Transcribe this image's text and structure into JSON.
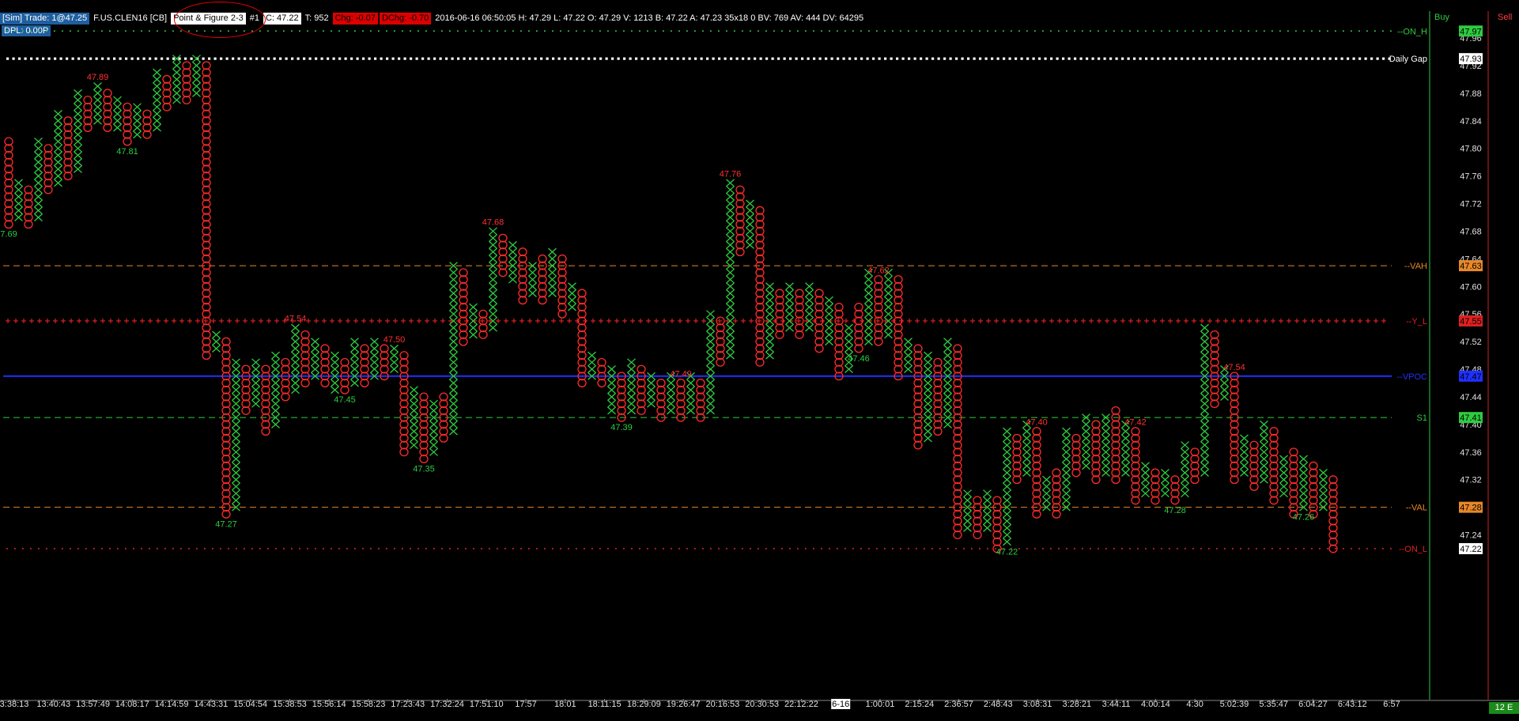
{
  "header": {
    "account": "[Sim]  Trade: 1@47.25",
    "instrument": "F.US.CLEN16 [CB]",
    "chart_type": "Point & Figure 2-3",
    "chart_no": "#1",
    "close": "C: 47.22",
    "ticks": "T: 952",
    "chg": "Chg: -0.07",
    "dchg": "DChg: -0.70",
    "stats": "2016-06-16 06:50:05  H: 47.29  L: 47.22  O: 47.29  V: 1213  B: 47.22  A: 47.23  35x18 0  BV: 769  AV: 444  DV: 64295",
    "dpl": "DPL: 0.00P",
    "buy": "Buy",
    "sell": "Sell",
    "corner": "12 E"
  },
  "chart_data": {
    "type": "point-and-figure",
    "ylim": [
      47.22,
      47.97
    ],
    "box_size": 0.01,
    "y_ticks": [
      47.96,
      47.92,
      47.88,
      47.84,
      47.8,
      47.76,
      47.72,
      47.68,
      47.64,
      47.6,
      47.56,
      47.52,
      47.48,
      47.44,
      47.4,
      47.36,
      47.32,
      47.28,
      47.24
    ],
    "x_ticks": [
      "3:38:13",
      "13:40:43",
      "13:57:49",
      "14:08:17",
      "14:14:59",
      "14:43:31",
      "15:04:54",
      "15:38:53",
      "15:56:14",
      "15:58:23",
      "17:23:43",
      "17:32:24",
      "17:51:10",
      "17:57",
      "18:01",
      "18:11:15",
      "18:29:09",
      "19:26:47",
      "20:16:53",
      "20:30:53",
      "22:12:22",
      "6-16",
      "1:00:01",
      "2:15:24",
      "2:36:57",
      "2:48:43",
      "3:08:31",
      "3:28:21",
      "3:44:11",
      "4:00:14",
      "4:30",
      "5:02:39",
      "5:35:47",
      "6:04:27",
      "6:43:12",
      "6:57"
    ],
    "levels": [
      {
        "name": "ON_H",
        "label": "--ON_H",
        "value": 47.97,
        "style": "dots",
        "color": "#2ecc40",
        "badge_color": "#2ecc40"
      },
      {
        "name": "Daily Gap",
        "label": "Daily Gap",
        "value": 47.93,
        "style": "bigdots",
        "color": "#ffffff",
        "badge_color": "#ffffff"
      },
      {
        "name": "VAH",
        "label": "--VAH",
        "value": 47.63,
        "style": "dash",
        "color": "#e8872a",
        "badge_color": "#e8872a"
      },
      {
        "name": "Y_L",
        "label": "--Y_L",
        "value": 47.55,
        "style": "plus",
        "color": "#e02020",
        "badge_color": "#e02020"
      },
      {
        "name": "VPOC",
        "label": "--VPOC",
        "value": 47.47,
        "style": "solid",
        "color": "#2030ff",
        "badge_color": "#2030ff"
      },
      {
        "name": "S1",
        "label": "S1",
        "value": 47.41,
        "style": "dash",
        "color": "#2ecc40",
        "badge_color": "#2ecc40"
      },
      {
        "name": "VAL",
        "label": "--VAL",
        "value": 47.28,
        "style": "dash",
        "color": "#e8872a",
        "badge_color": "#e8872a"
      },
      {
        "name": "ON_L",
        "label": "--ON_L",
        "value": 47.22,
        "style": "dots",
        "color": "#e02020",
        "badge_color": "#ffffff"
      }
    ],
    "columns": [
      {
        "t": "O",
        "h": 47.81,
        "l": 47.69
      },
      {
        "t": "X",
        "h": 47.75,
        "l": 47.7
      },
      {
        "t": "O",
        "h": 47.74,
        "l": 47.69
      },
      {
        "t": "X",
        "h": 47.81,
        "l": 47.7
      },
      {
        "t": "O",
        "h": 47.8,
        "l": 47.74
      },
      {
        "t": "X",
        "h": 47.85,
        "l": 47.75
      },
      {
        "t": "O",
        "h": 47.84,
        "l": 47.76
      },
      {
        "t": "X",
        "h": 47.88,
        "l": 47.77
      },
      {
        "t": "O",
        "h": 47.87,
        "l": 47.83
      },
      {
        "t": "X",
        "h": 47.89,
        "l": 47.84
      },
      {
        "t": "O",
        "h": 47.88,
        "l": 47.83
      },
      {
        "t": "X",
        "h": 47.87,
        "l": 47.83
      },
      {
        "t": "O",
        "h": 47.86,
        "l": 47.81
      },
      {
        "t": "X",
        "h": 47.86,
        "l": 47.82
      },
      {
        "t": "O",
        "h": 47.85,
        "l": 47.82
      },
      {
        "t": "X",
        "h": 47.91,
        "l": 47.83
      },
      {
        "t": "O",
        "h": 47.9,
        "l": 47.86
      },
      {
        "t": "X",
        "h": 47.93,
        "l": 47.87
      },
      {
        "t": "O",
        "h": 47.92,
        "l": 47.87
      },
      {
        "t": "X",
        "h": 47.93,
        "l": 47.88
      },
      {
        "t": "O",
        "h": 47.92,
        "l": 47.5
      },
      {
        "t": "X",
        "h": 47.53,
        "l": 47.51
      },
      {
        "t": "O",
        "h": 47.52,
        "l": 47.27
      },
      {
        "t": "X",
        "h": 47.49,
        "l": 47.28
      },
      {
        "t": "O",
        "h": 47.48,
        "l": 47.42
      },
      {
        "t": "X",
        "h": 47.49,
        "l": 47.43
      },
      {
        "t": "O",
        "h": 47.48,
        "l": 47.39
      },
      {
        "t": "X",
        "h": 47.5,
        "l": 47.4
      },
      {
        "t": "O",
        "h": 47.49,
        "l": 47.44
      },
      {
        "t": "X",
        "h": 47.54,
        "l": 47.45
      },
      {
        "t": "O",
        "h": 47.53,
        "l": 47.46
      },
      {
        "t": "X",
        "h": 47.52,
        "l": 47.47
      },
      {
        "t": "O",
        "h": 47.51,
        "l": 47.46
      },
      {
        "t": "X",
        "h": 47.5,
        "l": 47.45
      },
      {
        "t": "O",
        "h": 47.49,
        "l": 47.45
      },
      {
        "t": "X",
        "h": 47.52,
        "l": 47.46
      },
      {
        "t": "O",
        "h": 47.51,
        "l": 47.46
      },
      {
        "t": "X",
        "h": 47.52,
        "l": 47.47
      },
      {
        "t": "O",
        "h": 47.51,
        "l": 47.47
      },
      {
        "t": "X",
        "h": 47.51,
        "l": 47.48
      },
      {
        "t": "O",
        "h": 47.5,
        "l": 47.36
      },
      {
        "t": "X",
        "h": 47.45,
        "l": 47.37
      },
      {
        "t": "O",
        "h": 47.44,
        "l": 47.35
      },
      {
        "t": "X",
        "h": 47.43,
        "l": 47.36
      },
      {
        "t": "O",
        "h": 47.44,
        "l": 47.38
      },
      {
        "t": "X",
        "h": 47.63,
        "l": 47.39
      },
      {
        "t": "O",
        "h": 47.62,
        "l": 47.52
      },
      {
        "t": "X",
        "h": 47.57,
        "l": 47.53
      },
      {
        "t": "O",
        "h": 47.56,
        "l": 47.53
      },
      {
        "t": "X",
        "h": 47.68,
        "l": 47.54
      },
      {
        "t": "O",
        "h": 47.67,
        "l": 47.62
      },
      {
        "t": "X",
        "h": 47.66,
        "l": 47.61
      },
      {
        "t": "O",
        "h": 47.65,
        "l": 47.58
      },
      {
        "t": "X",
        "h": 47.63,
        "l": 47.59
      },
      {
        "t": "O",
        "h": 47.64,
        "l": 47.58
      },
      {
        "t": "X",
        "h": 47.65,
        "l": 47.59
      },
      {
        "t": "O",
        "h": 47.64,
        "l": 47.56
      },
      {
        "t": "X",
        "h": 47.6,
        "l": 47.57
      },
      {
        "t": "O",
        "h": 47.59,
        "l": 47.46
      },
      {
        "t": "X",
        "h": 47.5,
        "l": 47.47
      },
      {
        "t": "O",
        "h": 47.49,
        "l": 47.46
      },
      {
        "t": "X",
        "h": 47.48,
        "l": 47.42
      },
      {
        "t": "O",
        "h": 47.47,
        "l": 47.41
      },
      {
        "t": "X",
        "h": 47.49,
        "l": 47.42
      },
      {
        "t": "O",
        "h": 47.48,
        "l": 47.42
      },
      {
        "t": "X",
        "h": 47.47,
        "l": 47.43
      },
      {
        "t": "O",
        "h": 47.46,
        "l": 47.41
      },
      {
        "t": "X",
        "h": 47.47,
        "l": 47.42
      },
      {
        "t": "O",
        "h": 47.46,
        "l": 47.41
      },
      {
        "t": "X",
        "h": 47.47,
        "l": 47.42
      },
      {
        "t": "O",
        "h": 47.46,
        "l": 47.41
      },
      {
        "t": "X",
        "h": 47.56,
        "l": 47.42
      },
      {
        "t": "O",
        "h": 47.55,
        "l": 47.49
      },
      {
        "t": "X",
        "h": 47.75,
        "l": 47.5
      },
      {
        "t": "O",
        "h": 47.74,
        "l": 47.65
      },
      {
        "t": "X",
        "h": 47.72,
        "l": 47.66
      },
      {
        "t": "O",
        "h": 47.71,
        "l": 47.49
      },
      {
        "t": "X",
        "h": 47.6,
        "l": 47.5
      },
      {
        "t": "O",
        "h": 47.59,
        "l": 47.53
      },
      {
        "t": "X",
        "h": 47.6,
        "l": 47.54
      },
      {
        "t": "O",
        "h": 47.59,
        "l": 47.53
      },
      {
        "t": "X",
        "h": 47.6,
        "l": 47.54
      },
      {
        "t": "O",
        "h": 47.59,
        "l": 47.51
      },
      {
        "t": "X",
        "h": 47.58,
        "l": 47.52
      },
      {
        "t": "O",
        "h": 47.57,
        "l": 47.47
      },
      {
        "t": "X",
        "h": 47.54,
        "l": 47.48
      },
      {
        "t": "O",
        "h": 47.57,
        "l": 47.51
      },
      {
        "t": "X",
        "h": 47.62,
        "l": 47.52
      },
      {
        "t": "O",
        "h": 47.61,
        "l": 47.52
      },
      {
        "t": "X",
        "h": 47.62,
        "l": 47.53
      },
      {
        "t": "O",
        "h": 47.61,
        "l": 47.47
      },
      {
        "t": "X",
        "h": 47.52,
        "l": 47.48
      },
      {
        "t": "O",
        "h": 47.51,
        "l": 47.37
      },
      {
        "t": "X",
        "h": 47.5,
        "l": 47.38
      },
      {
        "t": "O",
        "h": 47.49,
        "l": 47.39
      },
      {
        "t": "X",
        "h": 47.52,
        "l": 47.4
      },
      {
        "t": "O",
        "h": 47.51,
        "l": 47.24
      },
      {
        "t": "X",
        "h": 47.3,
        "l": 47.25
      },
      {
        "t": "O",
        "h": 47.29,
        "l": 47.24
      },
      {
        "t": "X",
        "h": 47.3,
        "l": 47.25
      },
      {
        "t": "O",
        "h": 47.29,
        "l": 47.22
      },
      {
        "t": "X",
        "h": 47.39,
        "l": 47.23
      },
      {
        "t": "O",
        "h": 47.38,
        "l": 47.32
      },
      {
        "t": "X",
        "h": 47.4,
        "l": 47.33
      },
      {
        "t": "O",
        "h": 47.39,
        "l": 47.27
      },
      {
        "t": "X",
        "h": 47.32,
        "l": 47.28
      },
      {
        "t": "O",
        "h": 47.33,
        "l": 47.27
      },
      {
        "t": "X",
        "h": 47.39,
        "l": 47.28
      },
      {
        "t": "O",
        "h": 47.38,
        "l": 47.33
      },
      {
        "t": "X",
        "h": 47.41,
        "l": 47.34
      },
      {
        "t": "O",
        "h": 47.4,
        "l": 47.32
      },
      {
        "t": "X",
        "h": 47.41,
        "l": 47.33
      },
      {
        "t": "O",
        "h": 47.42,
        "l": 47.32
      },
      {
        "t": "X",
        "h": 47.4,
        "l": 47.33
      },
      {
        "t": "O",
        "h": 47.39,
        "l": 47.29
      },
      {
        "t": "X",
        "h": 47.34,
        "l": 47.3
      },
      {
        "t": "O",
        "h": 47.33,
        "l": 47.29
      },
      {
        "t": "X",
        "h": 47.33,
        "l": 47.3
      },
      {
        "t": "O",
        "h": 47.32,
        "l": 47.29
      },
      {
        "t": "X",
        "h": 47.37,
        "l": 47.3
      },
      {
        "t": "O",
        "h": 47.36,
        "l": 47.32
      },
      {
        "t": "X",
        "h": 47.54,
        "l": 47.33
      },
      {
        "t": "O",
        "h": 47.53,
        "l": 47.43
      },
      {
        "t": "X",
        "h": 47.48,
        "l": 47.44
      },
      {
        "t": "O",
        "h": 47.47,
        "l": 47.32
      },
      {
        "t": "X",
        "h": 47.38,
        "l": 47.33
      },
      {
        "t": "O",
        "h": 47.37,
        "l": 47.31
      },
      {
        "t": "X",
        "h": 47.4,
        "l": 47.32
      },
      {
        "t": "O",
        "h": 47.39,
        "l": 47.29
      },
      {
        "t": "X",
        "h": 47.35,
        "l": 47.3
      },
      {
        "t": "O",
        "h": 47.36,
        "l": 47.27
      },
      {
        "t": "X",
        "h": 47.35,
        "l": 47.28
      },
      {
        "t": "O",
        "h": 47.34,
        "l": 47.27
      },
      {
        "t": "X",
        "h": 47.33,
        "l": 47.28
      },
      {
        "t": "O",
        "h": 47.32,
        "l": 47.22
      }
    ],
    "price_labels": [
      {
        "col": 0,
        "text": "7.69",
        "color": "#2ecc40",
        "pos": "below"
      },
      {
        "col": 9,
        "text": "47.89",
        "color": "#ff3030",
        "pos": "above"
      },
      {
        "col": 12,
        "text": "47.81",
        "color": "#2ecc40",
        "pos": "below"
      },
      {
        "col": 22,
        "text": "47.27",
        "color": "#2ecc40",
        "pos": "below"
      },
      {
        "col": 29,
        "text": "47.54",
        "color": "#ff3030",
        "pos": "above"
      },
      {
        "col": 34,
        "text": "47.45",
        "color": "#2ecc40",
        "pos": "below"
      },
      {
        "col": 39,
        "text": "47.50",
        "color": "#ff3030",
        "pos": "above"
      },
      {
        "col": 42,
        "text": "47.35",
        "color": "#2ecc40",
        "pos": "below"
      },
      {
        "col": 49,
        "text": "47.68",
        "color": "#ff3030",
        "pos": "above"
      },
      {
        "col": 62,
        "text": "47.39",
        "color": "#2ecc40",
        "pos": "below"
      },
      {
        "col": 68,
        "text": "47.49",
        "color": "#ff3030",
        "pos": "above"
      },
      {
        "col": 73,
        "text": "47.76",
        "color": "#ff3030",
        "pos": "above"
      },
      {
        "col": 86,
        "text": "47.46",
        "color": "#2ecc40",
        "pos": "below"
      },
      {
        "col": 88,
        "text": "47.62",
        "color": "#ff3030",
        "pos": "above"
      },
      {
        "col": 101,
        "text": "47.22",
        "color": "#2ecc40",
        "pos": "below"
      },
      {
        "col": 104,
        "text": "47.40",
        "color": "#ff3030",
        "pos": "above"
      },
      {
        "col": 114,
        "text": "47.42",
        "color": "#ff3030",
        "pos": "above"
      },
      {
        "col": 118,
        "text": "47.28",
        "color": "#2ecc40",
        "pos": "below"
      },
      {
        "col": 124,
        "text": "47.54",
        "color": "#ff3030",
        "pos": "above"
      },
      {
        "col": 131,
        "text": "47.26",
        "color": "#2ecc40",
        "pos": "below"
      }
    ],
    "axis_badges": [
      {
        "value": 47.97,
        "text": "47.97",
        "bg": "#2ecc40",
        "fg": "#000"
      },
      {
        "value": 47.93,
        "text": "47.93",
        "bg": "#ffffff",
        "fg": "#000"
      },
      {
        "value": 47.63,
        "text": "47.63",
        "bg": "#e8872a",
        "fg": "#000"
      },
      {
        "value": 47.55,
        "text": "47.55",
        "bg": "#e02020",
        "fg": "#000"
      },
      {
        "value": 47.47,
        "text": "47.47",
        "bg": "#2030ff",
        "fg": "#000"
      },
      {
        "value": 47.41,
        "text": "47.41",
        "bg": "#2ecc40",
        "fg": "#000"
      },
      {
        "value": 47.28,
        "text": "47.28",
        "bg": "#e8872a",
        "fg": "#000"
      },
      {
        "value": 47.22,
        "text": "47.22",
        "bg": "#ffffff",
        "fg": "#000"
      }
    ],
    "date_marker": "6-16",
    "colors": {
      "x": "#2ecc40",
      "o": "#ff2a2a",
      "axis_text": "#e0e0e0",
      "frame": "#2ecc40"
    }
  }
}
